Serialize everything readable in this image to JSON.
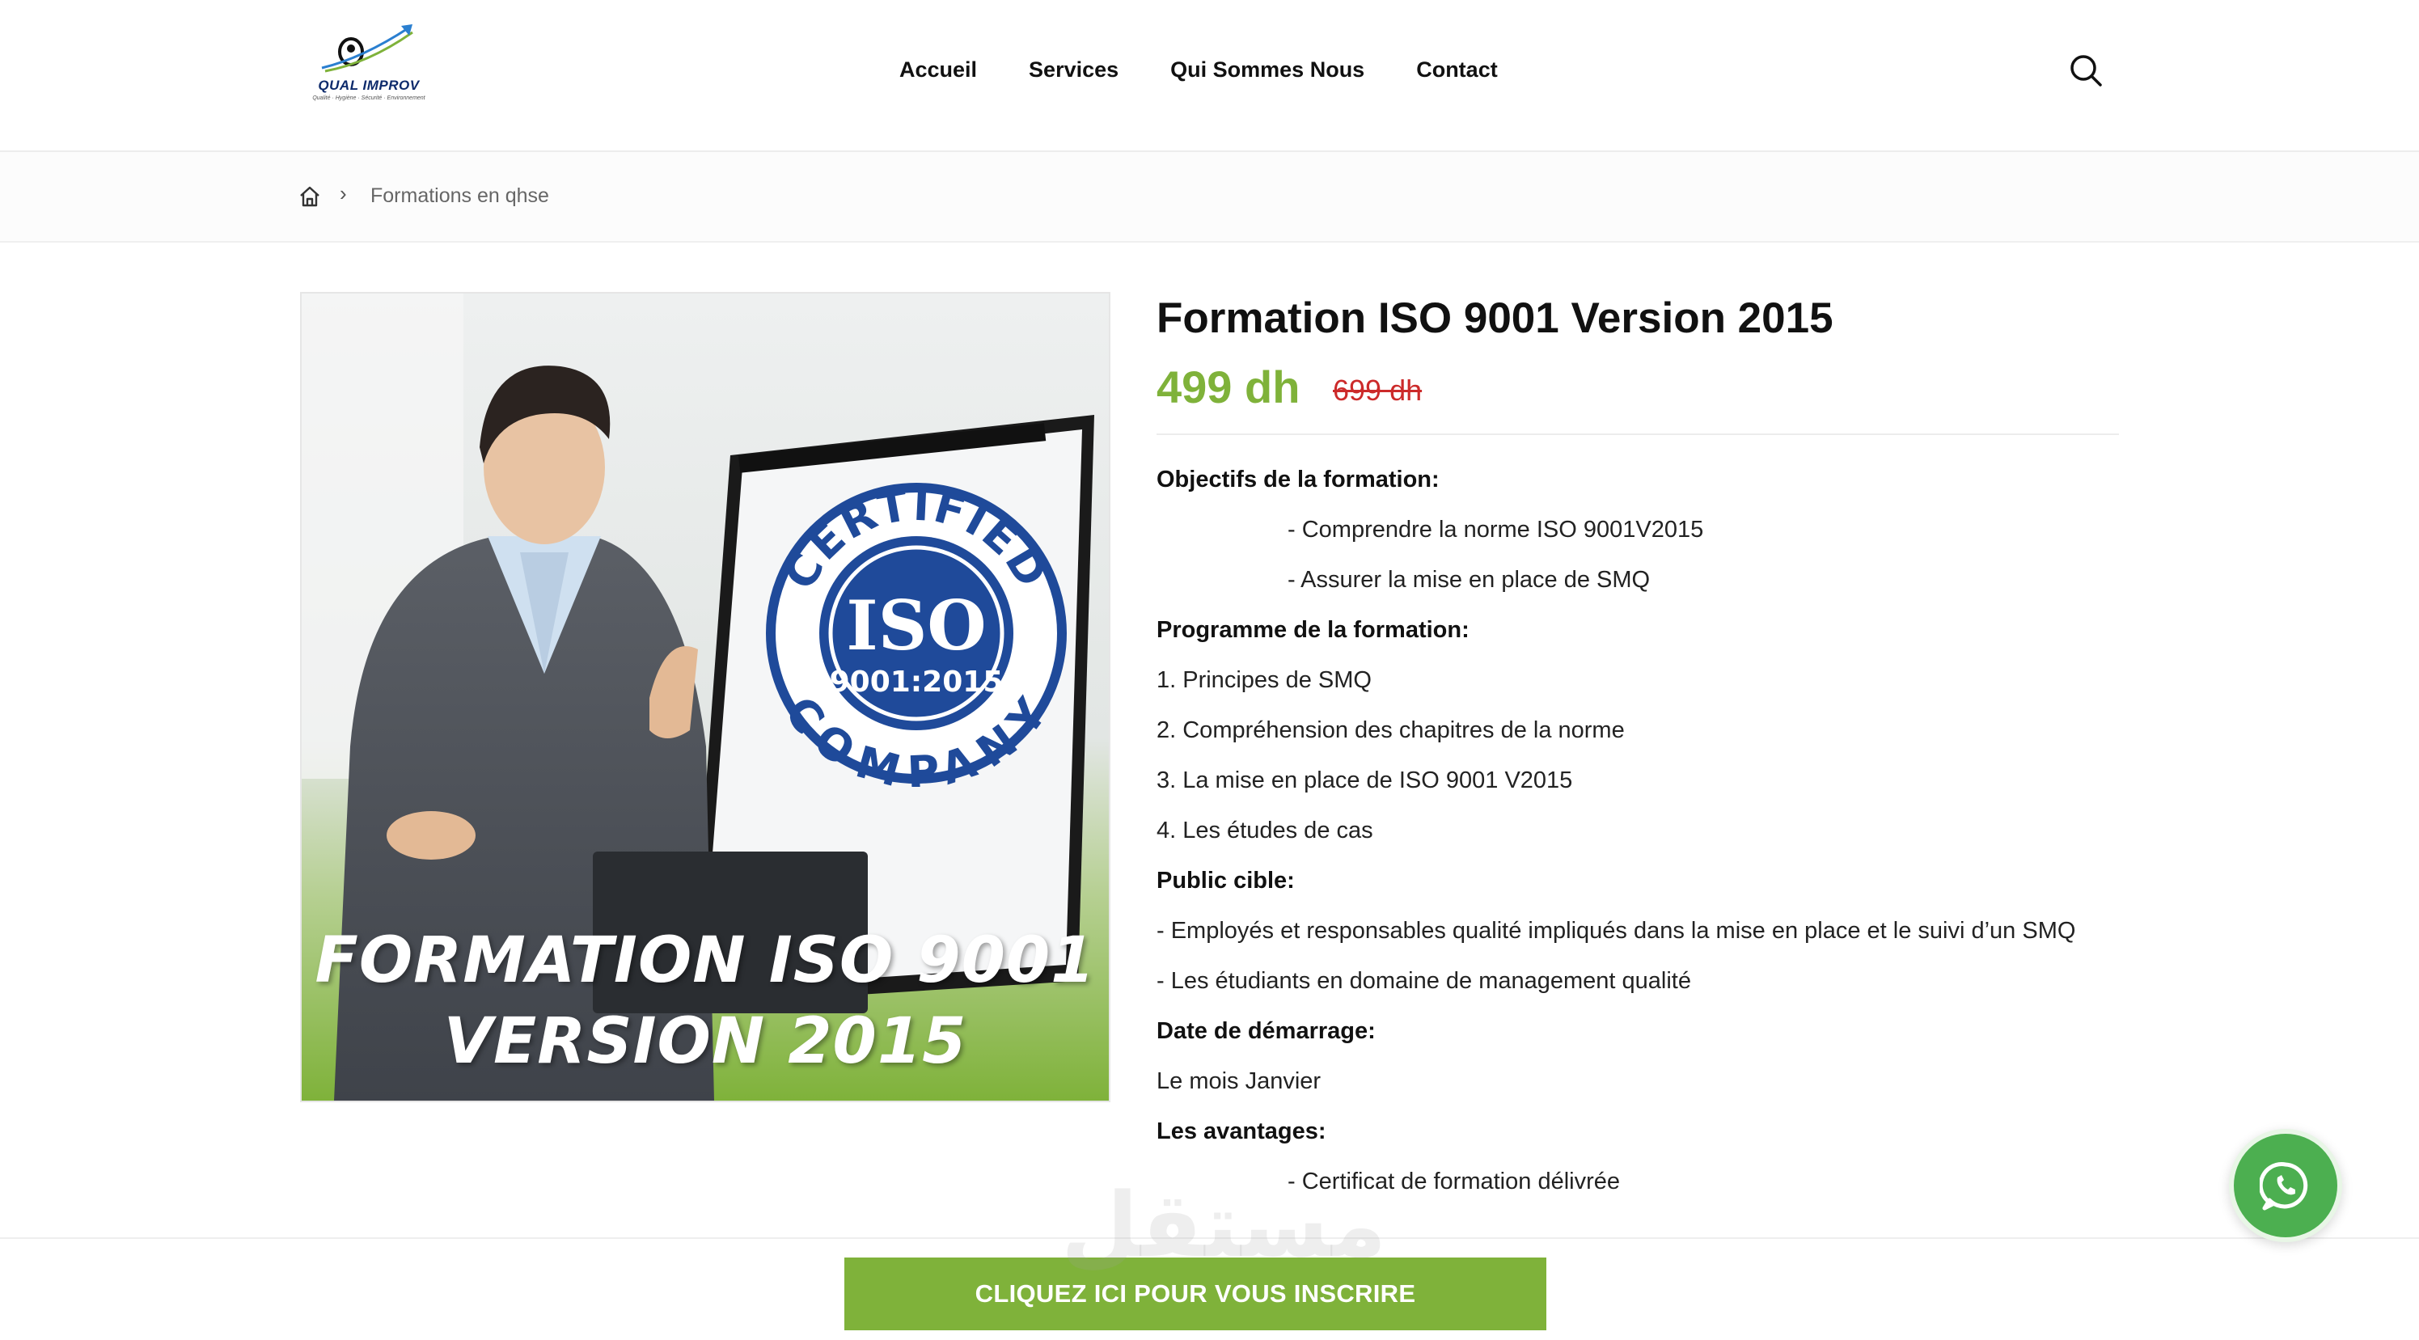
{
  "header": {
    "logo": {
      "name": "QUAL IMPROV",
      "tagline": "Qualité · Hygiène · Sécurité · Environnement"
    },
    "nav": [
      {
        "label": "Accueil"
      },
      {
        "label": "Services"
      },
      {
        "label": "Qui Sommes Nous"
      },
      {
        "label": "Contact"
      }
    ],
    "search_icon": "search-icon"
  },
  "breadcrumb": {
    "home_icon": "home-icon",
    "separator": "›",
    "current": "Formations en qhse"
  },
  "product": {
    "image": {
      "badge_top": "CERTIFIED",
      "badge_main": "ISO",
      "badge_sub": "9001:2015",
      "badge_bottom": "COMPANY",
      "caption_line1": "FORMATION ISO 9001",
      "caption_line2": "VERSION 2015"
    },
    "title": "Formation ISO 9001 Version 2015",
    "price": "499 dh",
    "old_price": "699 dh",
    "description": {
      "objectifs_heading": "Objectifs de la formation:",
      "objectifs": [
        "- Comprendre la norme ISO 9001V2015",
        "- Assurer la mise en place de SMQ"
      ],
      "programme_heading": "Programme de la formation:",
      "programme": [
        "1. Principes de SMQ",
        "2. Compréhension des chapitres de la norme",
        "3. La mise en place de ISO 9001 V2015",
        "4. Les études de cas"
      ],
      "public_heading": "Public cible:",
      "public": [
        "- Employés et responsables qualité impliqués dans la mise en place et le suivi d’un SMQ",
        "- Les étudiants en domaine de management qualité"
      ],
      "date_heading": "Date de démarrage:",
      "date": "Le mois Janvier",
      "avantages_heading": "Les avantages:",
      "avantages": [
        "- Certificat de formation délivrée"
      ]
    }
  },
  "sticky_bar": {
    "cta_label": "CLIQUEZ ICI POUR VOUS INSCRIRE",
    "watermark": "مستقل"
  },
  "whatsapp": {
    "icon": "whatsapp-icon"
  },
  "colors": {
    "accent_green": "#7fb23a",
    "old_price_red": "#cc2a2a",
    "whatsapp_green": "#4caf50",
    "badge_blue": "#1f4a9a"
  }
}
